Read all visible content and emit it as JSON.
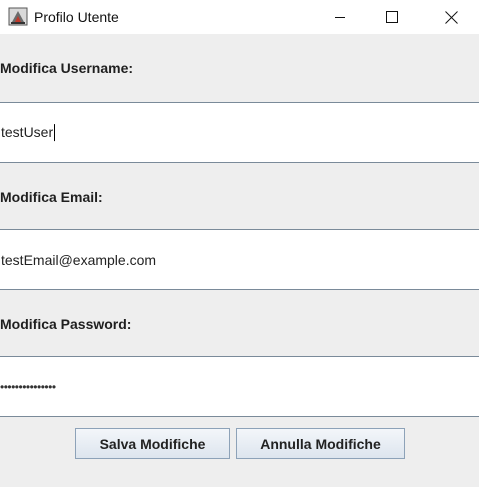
{
  "window": {
    "title": "Profilo Utente",
    "icon": "java-app-icon",
    "controls": [
      "minimize-icon",
      "maximize-icon",
      "close-icon"
    ]
  },
  "form": {
    "username": {
      "label": "Modifica Username:",
      "value": "testUser"
    },
    "email": {
      "label": "Modifica Email:",
      "value": "testEmail@example.com"
    },
    "password": {
      "label": "Modifica Password:",
      "masked_value": "•••••••••••••••"
    }
  },
  "buttons": {
    "save": "Salva Modifiche",
    "cancel": "Annulla Modifiche"
  },
  "colors": {
    "background": "#eeeeee",
    "field_background": "#ffffff",
    "field_border": "#7a8a99",
    "button_border": "#8da2b8"
  }
}
